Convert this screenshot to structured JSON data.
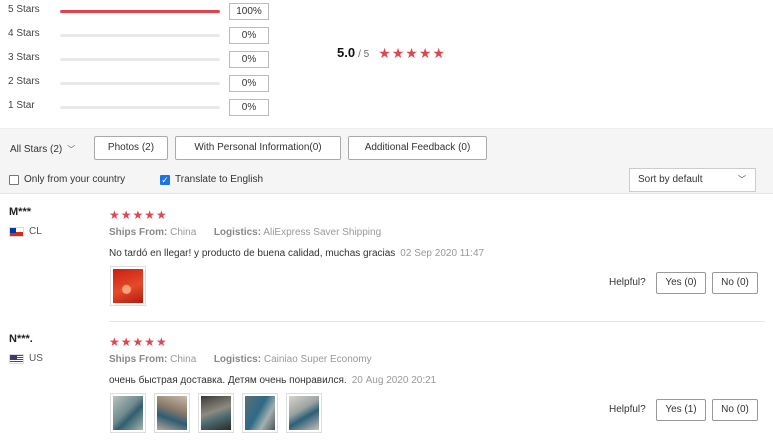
{
  "breakdown": [
    {
      "label": "5 Stars",
      "percent": "100%",
      "fill": 1.0
    },
    {
      "label": "4 Stars",
      "percent": "0%",
      "fill": 0
    },
    {
      "label": "3 Stars",
      "percent": "0%",
      "fill": 0
    },
    {
      "label": "2 Stars",
      "percent": "0%",
      "fill": 0
    },
    {
      "label": "1 Star",
      "percent": "0%",
      "fill": 0
    }
  ],
  "summary": {
    "score": "5.0",
    "out_of": "/ 5",
    "stars": "★★★★★"
  },
  "filters": {
    "all_stars": "All Stars (2)",
    "photos": "Photos (2)",
    "personal": "With Personal Information(0)",
    "additional": "Additional Feedback (0)",
    "only_country": "Only from your country",
    "only_country_checked": false,
    "translate": "Translate to English",
    "translate_checked": true,
    "sort": "Sort by default"
  },
  "accent_color": "#e14552",
  "reviews": [
    {
      "name": "M***",
      "country": "CL",
      "stars": "★★★★★",
      "ships_label": "Ships From:",
      "ships_value": "China",
      "logistics_label": "Logistics:",
      "logistics_value": "AliExpress Saver Shipping",
      "text": "No tardó en llegar! y producto de buena calidad, muchas gracias",
      "date": "02 Sep 2020 11:47",
      "helpful": "Helpful?",
      "yes": "Yes (0)",
      "no": "No (0)"
    },
    {
      "name": "N***.",
      "country": "US",
      "stars": "★★★★★",
      "ships_label": "Ships From:",
      "ships_value": "China",
      "logistics_label": "Logistics:",
      "logistics_value": "Cainiao Super Economy",
      "text": "очень быстрая доставка. Детям очень понравился.",
      "date": "20 Aug 2020 20:21",
      "helpful": "Helpful?",
      "yes": "Yes (1)",
      "no": "No (0)"
    }
  ]
}
